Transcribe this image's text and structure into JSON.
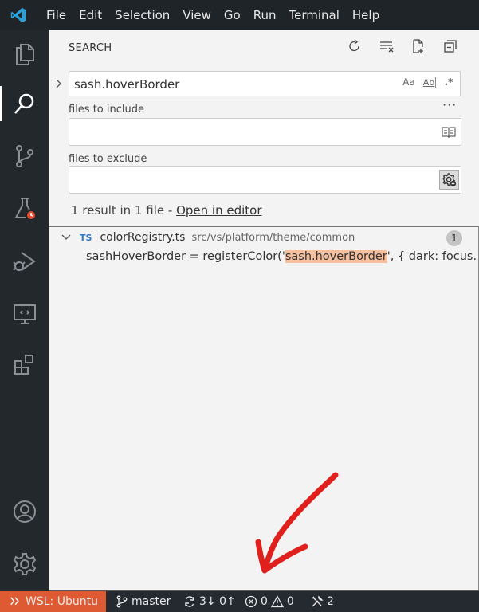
{
  "menu": {
    "items": [
      "File",
      "Edit",
      "Selection",
      "View",
      "Go",
      "Run",
      "Terminal",
      "Help"
    ]
  },
  "activity_bar": {
    "icons": [
      "files-icon",
      "search-icon",
      "source-control-icon",
      "testing-icon",
      "run-debug-icon",
      "remote-explorer-icon",
      "extensions-icon",
      "accounts-icon",
      "settings-gear-icon"
    ]
  },
  "search": {
    "title": "SEARCH",
    "query": "sash.hoverBorder",
    "match_case": "Aa",
    "whole_word": "Ab",
    "regex": ".*",
    "more": "···",
    "include_label": "files to include",
    "include_value": "",
    "exclude_label": "files to exclude",
    "exclude_value": "",
    "summary_text": "1 result in 1 file - ",
    "open_in_editor": "Open in editor"
  },
  "results": {
    "file": {
      "lang_badge": "TS",
      "name": "colorRegistry.ts",
      "path": "src/vs/platform/theme/common",
      "count": "1"
    },
    "match": {
      "before": "sashHoverBorder = registerColor('",
      "highlight": "sash.hoverBorder",
      "after": "', { dark: focus..."
    }
  },
  "status_bar": {
    "remote": "WSL: Ubuntu",
    "branch": "master",
    "sync": "3↓ 0↑",
    "errors": "0",
    "warnings": "0",
    "ports": "2"
  },
  "colors": {
    "titlebar_bg": "#1f2428",
    "activity_bg": "#23282d",
    "remote_bg": "#de5a33",
    "highlight": "#f6bf9d",
    "annotation": "#e0201c"
  }
}
